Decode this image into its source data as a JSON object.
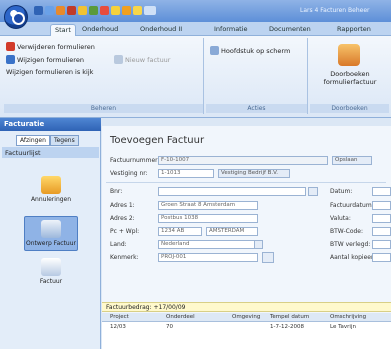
{
  "titlebar": {
    "title": "Lars 4 Facturen Beheer"
  },
  "tabs": [
    "Start",
    "Onderhoud",
    "Onderhoud II",
    "Informatie",
    "Documenten",
    "Rapporten"
  ],
  "ribbon": {
    "beheren": {
      "label": "Beheren",
      "items": [
        "Verwijderen formulieren",
        "Wijzigen formulieren",
        "Wijzigen formulieren is kijk"
      ],
      "disabled": "Nieuw factuur"
    },
    "acties": {
      "label": "Acties",
      "items": [
        "Hoofdstuk op scherm"
      ]
    },
    "doorboeken": {
      "label": "Doorboeken",
      "button": "Doorboeken formulierfactuur"
    }
  },
  "nav": {
    "header": "Facturatie",
    "tabs": [
      "Afzingen",
      "Tegens"
    ],
    "section": "Factuurlijst",
    "items": [
      "Annuleringen",
      "Ontwerp Factuur",
      "Factuur"
    ]
  },
  "form": {
    "title": "Toevoegen Factuur",
    "labels": {
      "factuurnummer": "Factuurnummer:",
      "vestiging": "Vestiging nr:",
      "bnr": "Bnr:",
      "adres1": "Adres 1:",
      "adres2": "Adres 2:",
      "pc": "Pc + Wpl:",
      "land": "Land:",
      "kenmerk": "Kenmerk:",
      "datum": "Datum:",
      "factuurdatum": "Factuurdatum:",
      "valuta": "Valuta:",
      "btwcode": "BTW-Code:",
      "btwverlegd": "BTW verlegd:",
      "aantal": "Aantal kopieen:"
    },
    "values": {
      "factuurnummer": "F-10-1007",
      "vestiging": "1-1013",
      "vestiging_btn": "Vestiging Bedrijf B.V.",
      "bnr": "",
      "adres1": "Groen Straat 8 Amsterdam",
      "adres2": "Postbus 1038",
      "pc": "1234 AB",
      "pc2": "AMSTERDAM",
      "land": "Nederland",
      "kenmerk": "PROJ-001",
      "action_btn": "Opslaan"
    }
  },
  "summary": "Factuurbedrag: +17/00/09",
  "table": {
    "headers": [
      "Project",
      "Onderdeel",
      "Omgeving",
      "Tempel datum",
      "Omschrijving"
    ],
    "row": [
      "12/03",
      "70",
      "",
      "1-7-12-2008",
      "Le Tavrijn"
    ]
  },
  "colors": {
    "accent": "#2f63b5",
    "ribbon": "#dbe7f6",
    "summary": "#fff9cc"
  }
}
